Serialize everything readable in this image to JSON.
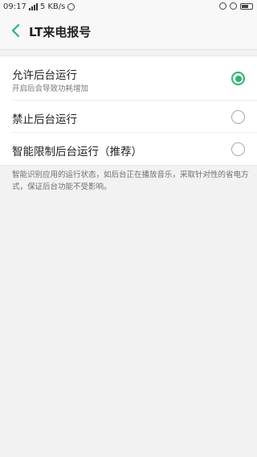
{
  "status_bar": {
    "time": "09:17",
    "speed": "5 KB/s"
  },
  "header": {
    "title": "LT来电报号"
  },
  "options": [
    {
      "label": "允许后台运行",
      "subtitle": "开启后会导致功耗增加",
      "selected": true
    },
    {
      "label": "禁止后台运行",
      "selected": false
    },
    {
      "label": "智能限制后台运行（推荐）",
      "selected": false
    }
  ],
  "description": "智能识别应用的运行状态，如后台正在播放音乐，采取针对性的省电方式，保证后台功能不受影响。",
  "colors": {
    "accent": "#2bb673"
  }
}
